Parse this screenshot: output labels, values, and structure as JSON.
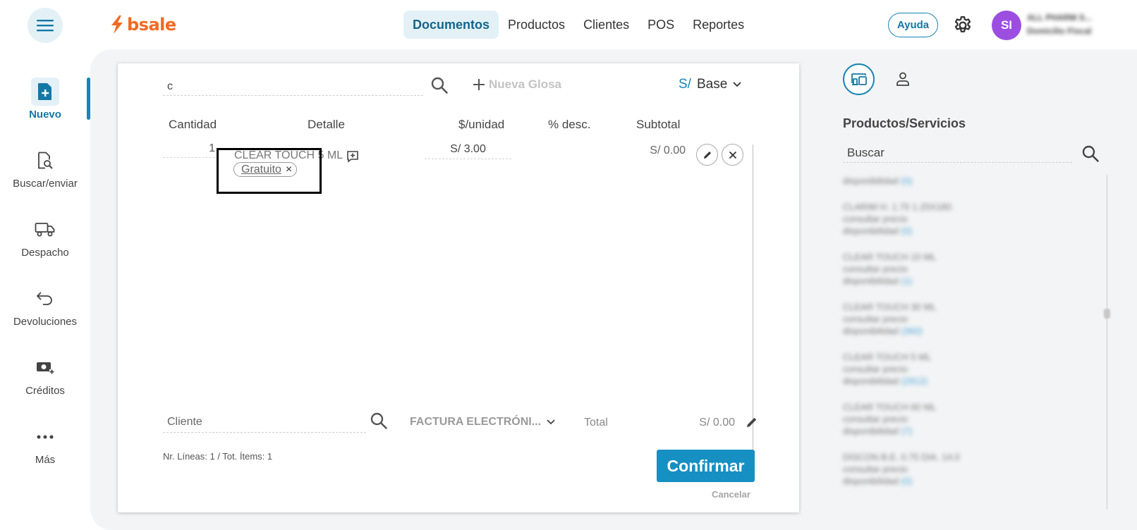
{
  "app": {
    "logo_text": "bsale",
    "brand_color": "#f26a21",
    "accent_color": "#1985b3"
  },
  "topnav": {
    "items": [
      {
        "label": "Documentos",
        "active": true
      },
      {
        "label": "Productos",
        "active": false
      },
      {
        "label": "Clientes",
        "active": false
      },
      {
        "label": "POS",
        "active": false
      },
      {
        "label": "Reportes",
        "active": false
      }
    ],
    "help_label": "Ayuda",
    "avatar_initials": "SI",
    "user_name_blurred": "ALL PHARM S...",
    "user_sub_blurred": "Domicilio Fiscal"
  },
  "sidebar": {
    "items": [
      {
        "label": "Nuevo",
        "icon": "new-document-icon",
        "active": true
      },
      {
        "label": "Buscar/enviar",
        "icon": "search-document-icon",
        "active": false
      },
      {
        "label": "Despacho",
        "icon": "truck-icon",
        "active": false
      },
      {
        "label": "Devoluciones",
        "icon": "return-arrow-icon",
        "active": false
      },
      {
        "label": "Créditos",
        "icon": "money-plus-icon",
        "active": false
      },
      {
        "label": "Más",
        "icon": "more-dots-icon",
        "active": false
      }
    ]
  },
  "document": {
    "product_search_value": "c",
    "new_glosa_label": "Nueva Glosa",
    "currency_symbol": "S/",
    "price_list": "Base",
    "columns": {
      "quantity": "Cantidad",
      "detail": "Detalle",
      "unit_price": "$/unidad",
      "discount": "% desc.",
      "subtotal": "Subtotal"
    },
    "line": {
      "quantity": "1",
      "name": "CLEAR TOUCH 5 ML",
      "tag": "Gratuito",
      "tag_close": "×",
      "unit_price": "S/ 3.00",
      "subtotal": "S/ 0.00"
    },
    "client_placeholder": "Cliente",
    "document_type": "FACTURA ELECTRÓNI...",
    "total_label": "Total",
    "total_value": "S/ 0.00",
    "summary": "Nr. Líneas: 1 / Tot. Ítems: 1",
    "confirm_label": "Confirmar",
    "cancel_label": "Cancelar"
  },
  "right_panel": {
    "title": "Productos/Servicios",
    "search_placeholder": "Buscar",
    "items": [
      {
        "lines": [
          "disponibilidad "
        ],
        "avail": "(0)"
      },
      {
        "lines": [
          "CLARIM H. 1.75 1.25X180",
          "consultar precio",
          "disponibilidad "
        ],
        "avail": "(0)"
      },
      {
        "lines": [
          "CLEAR TOUCH 10 ML",
          "consultar precio",
          "disponibilidad "
        ],
        "avail": "(1)"
      },
      {
        "lines": [
          "CLEAR TOUCH 30 ML",
          "consultar precio",
          "disponibilidad "
        ],
        "avail": "(360)"
      },
      {
        "lines": [
          "CLEAR TOUCH 5 ML",
          "consultar precio",
          "disponibilidad "
        ],
        "avail": "(2912)"
      },
      {
        "lines": [
          "CLEAR TOUCH 60 ML",
          "consultar precio",
          "disponibilidad "
        ],
        "avail": "(7)"
      },
      {
        "lines": [
          "DISCON B.E. 0.75 DIA. 14.0",
          "consultar precio",
          "disponibilidad "
        ],
        "avail": "(0)"
      }
    ]
  }
}
